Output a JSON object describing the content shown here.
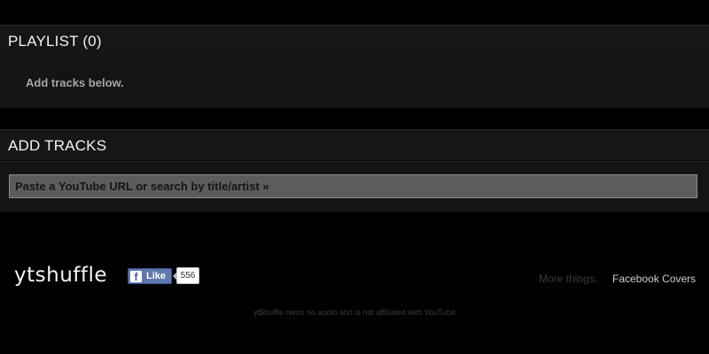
{
  "playlist": {
    "title": "PLAYLIST (0)",
    "empty_message": "Add tracks below."
  },
  "add_tracks": {
    "title": "ADD TRACKS",
    "search_placeholder": "Paste a YouTube URL or search by title/artist »"
  },
  "footer": {
    "logo_text": "ytshuffle",
    "facebook": {
      "icon": "facebook-icon",
      "like_label": "Like",
      "like_count": "556"
    },
    "more_label": "More things:",
    "more_link": "Facebook Covers",
    "disclaimer": "yt$huffle owns no audio and is not affiliated with YouTube"
  },
  "colors": {
    "background": "#000000",
    "panel": "#141414",
    "input_bg": "#5c5c5c",
    "facebook_blue": "#5f78ab"
  }
}
